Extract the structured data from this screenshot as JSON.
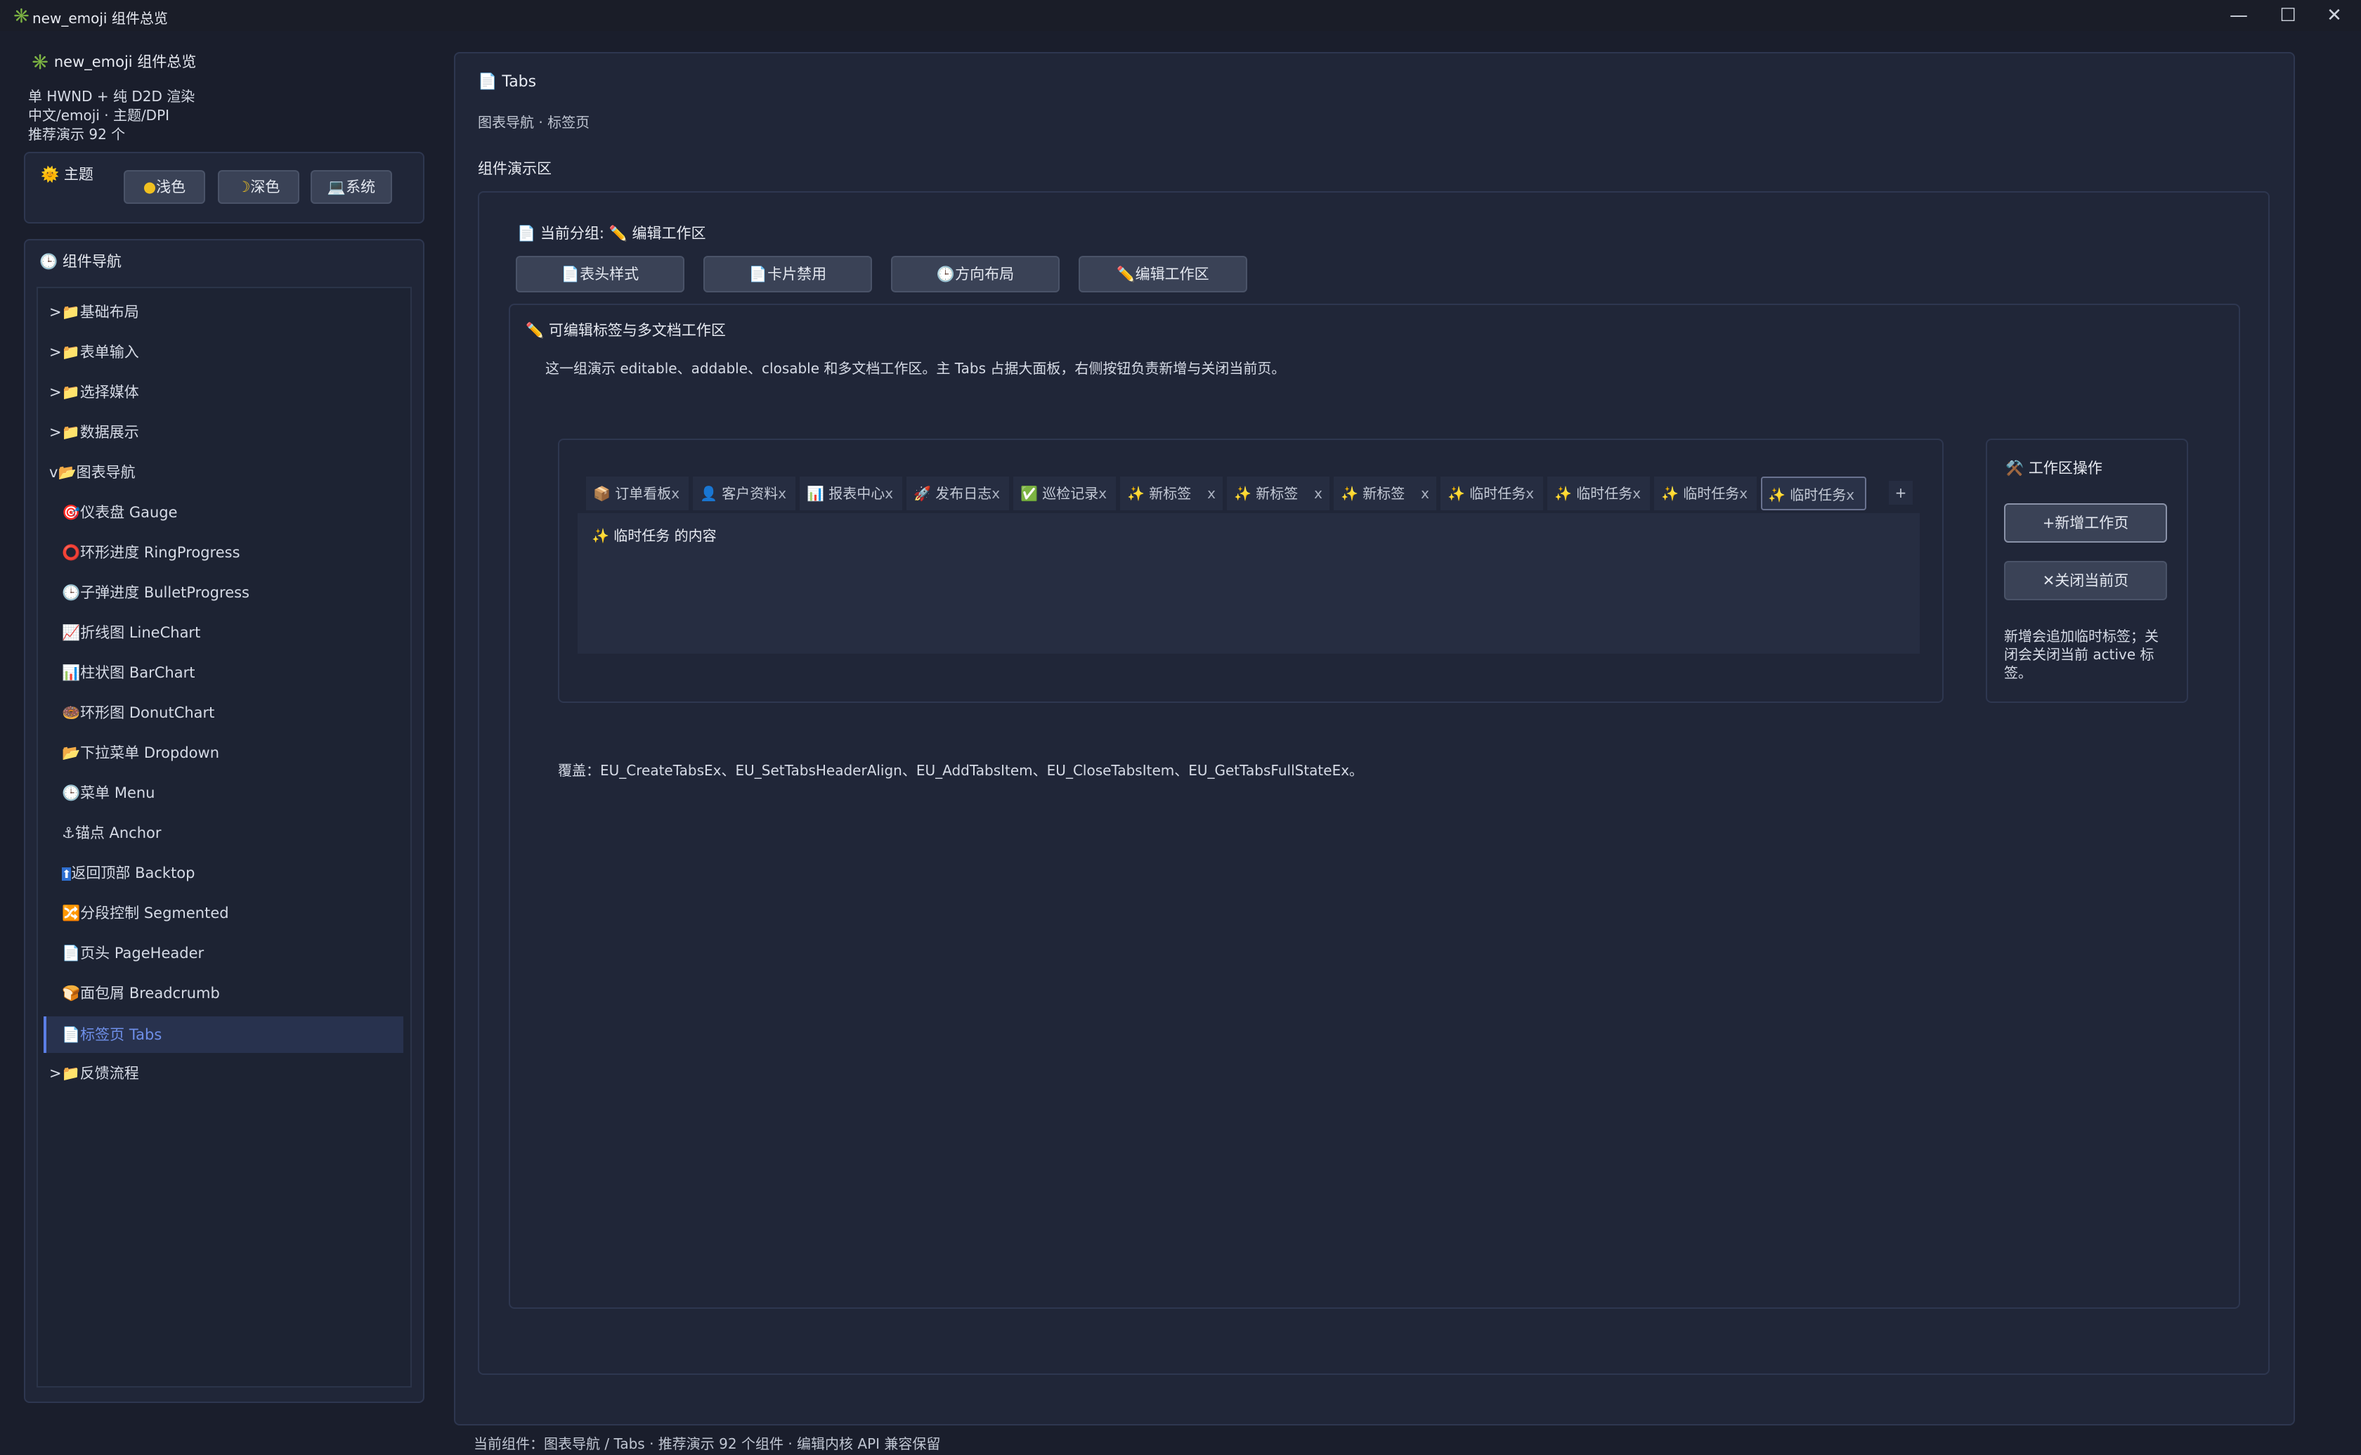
{
  "window": {
    "title": "new_emoji 组件总览",
    "controls": [
      "—",
      "☐",
      "✕"
    ]
  },
  "sidebar": {
    "app_title": "new_emoji 组件总览",
    "desc_lines": [
      "单 HWND + 纯 D2D 渲染",
      "中文/emoji · 主题/DPI",
      "推荐演示 92 个"
    ],
    "theme": {
      "label": "主题",
      "buttons": [
        "浅色",
        "深色",
        "系统"
      ]
    },
    "nav": {
      "title": "组件导航",
      "groups_top": [
        {
          "arrow": ">",
          "label": "基础布局"
        },
        {
          "arrow": ">",
          "label": "表单输入"
        },
        {
          "arrow": ">",
          "label": "选择媒体"
        },
        {
          "arrow": ">",
          "label": "数据展示"
        },
        {
          "arrow": "v",
          "label": "图表导航"
        }
      ],
      "items": [
        {
          "icon": "🎯",
          "label": "仪表盘 Gauge"
        },
        {
          "icon": "⭕",
          "label": "环形进度 RingProgress"
        },
        {
          "icon": "🕒",
          "label": "子弹进度 BulletProgress"
        },
        {
          "icon": "📈",
          "label": "折线图 LineChart"
        },
        {
          "icon": "📊",
          "label": "柱状图 BarChart"
        },
        {
          "icon": "🍩",
          "label": "环形图 DonutChart"
        },
        {
          "icon": "📂",
          "label": "下拉菜单 Dropdown"
        },
        {
          "icon": "🕒",
          "label": "菜单 Menu"
        },
        {
          "icon": "⚓",
          "label": "锚点 Anchor"
        },
        {
          "icon": "⬆",
          "label": "返回顶部 Backtop"
        },
        {
          "icon": "🔀",
          "label": "分段控制 Segmented"
        },
        {
          "icon": "📄",
          "label": "页头 PageHeader"
        },
        {
          "icon": "🍞",
          "label": "面包屑 Breadcrumb"
        },
        {
          "icon": "📄",
          "label": "标签页 Tabs"
        }
      ],
      "groups_bottom": [
        {
          "arrow": ">",
          "label": "反馈流程"
        }
      ]
    }
  },
  "main": {
    "title": "Tabs",
    "subtitle": "图表导航 · 标签页",
    "demo_label": "组件演示区",
    "current_group_label": "当前分组:",
    "current_group_value": "编辑工作区",
    "group_buttons": [
      "表头样式",
      "卡片禁用",
      "方向布局",
      "编辑工作区"
    ],
    "section": {
      "title": "可编辑标签与多文档工作区",
      "desc": "这一组演示 editable、addable、closable 和多文档工作区。主 Tabs 占据大面板，右侧按钮负责新增与关闭当前页。"
    },
    "tabs": [
      {
        "icon": "📦",
        "label": "订单看板",
        "close": "x"
      },
      {
        "icon": "👤",
        "label": "客户资料",
        "close": "x"
      },
      {
        "icon": "📊",
        "label": "报表中心",
        "close": "x"
      },
      {
        "icon": "🚀",
        "label": "发布日志",
        "close": "x"
      },
      {
        "icon": "✅",
        "label": "巡检记录",
        "close": "x"
      },
      {
        "icon": "✨",
        "label": "新标签",
        "close": "x"
      },
      {
        "icon": "✨",
        "label": "新标签",
        "close": "x"
      },
      {
        "icon": "✨",
        "label": "新标签",
        "close": "x"
      },
      {
        "icon": "✨",
        "label": "临时任务",
        "close": "x"
      },
      {
        "icon": "✨",
        "label": "临时任务",
        "close": "x"
      },
      {
        "icon": "✨",
        "label": "临时任务",
        "close": "x"
      },
      {
        "icon": "✨",
        "label": "临时任务",
        "close": "x"
      }
    ],
    "add_tab": "+",
    "tab_content": "临时任务 的内容",
    "workspace": {
      "title": "工作区操作",
      "add_button": "新增工作页",
      "close_button": "关闭当前页",
      "note": "新增会追加临时标签；关闭会关闭当前 active 标签。"
    },
    "coverage": "覆盖：EU_CreateTabsEx、EU_SetTabsHeaderAlign、EU_AddTabsItem、EU_CloseTabsItem、EU_GetTabsFullStateEx。"
  },
  "status_bar": "当前组件：图表导航 / Tabs · 推荐演示 92 个组件 · 编辑内核 API 兼容保留",
  "colors": {
    "background": "#1a1e2c",
    "panel": "#202638",
    "accent": "#5b7ee5",
    "selected_text": "#6e8fe8"
  }
}
